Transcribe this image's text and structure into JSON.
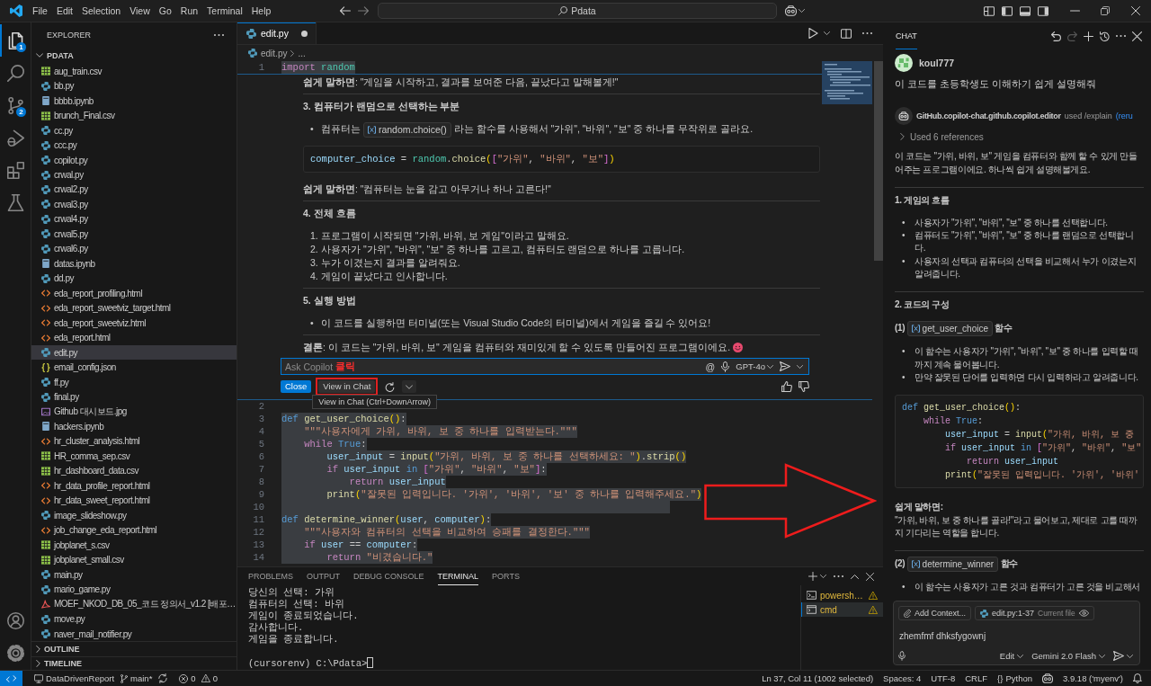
{
  "title_bar": {
    "menu": [
      "File",
      "Edit",
      "Selection",
      "View",
      "Go",
      "Run",
      "Terminal",
      "Help"
    ],
    "search": "Pdata"
  },
  "activity_bar": {
    "items": [
      {
        "kind": "files",
        "selected": true,
        "badge": "1"
      },
      {
        "kind": "search",
        "selected": false
      },
      {
        "kind": "source-control",
        "selected": false,
        "badge": "2"
      },
      {
        "kind": "run",
        "selected": false
      },
      {
        "kind": "extensions",
        "selected": false
      },
      {
        "kind": "testing",
        "selected": false
      }
    ]
  },
  "sidebar": {
    "title": "EXPLORER",
    "folder": {
      "name": "PDATA",
      "expanded": true,
      "files": [
        {
          "name": "aug_train.csv",
          "kind": "csv",
          "selected": false
        },
        {
          "name": "bb.py",
          "kind": "python",
          "selected": false
        },
        {
          "name": "bbbb.ipynb",
          "kind": "notebook",
          "selected": false
        },
        {
          "name": "brunch_Final.csv",
          "kind": "csv",
          "selected": false
        },
        {
          "name": "cc.py",
          "kind": "python",
          "selected": false
        },
        {
          "name": "ccc.py",
          "kind": "python",
          "selected": false
        },
        {
          "name": "copilot.py",
          "kind": "python",
          "selected": false
        },
        {
          "name": "crwal.py",
          "kind": "python",
          "selected": false
        },
        {
          "name": "crwal2.py",
          "kind": "python",
          "selected": false
        },
        {
          "name": "crwal3.py",
          "kind": "python",
          "selected": false
        },
        {
          "name": "crwal4.py",
          "kind": "python",
          "selected": false
        },
        {
          "name": "crwal5.py",
          "kind": "python",
          "selected": false
        },
        {
          "name": "crwal6.py",
          "kind": "python",
          "selected": false
        },
        {
          "name": "datas.ipynb",
          "kind": "notebook",
          "selected": false
        },
        {
          "name": "dd.py",
          "kind": "python",
          "selected": false
        },
        {
          "name": "eda_report_profiling.html",
          "kind": "html",
          "selected": false
        },
        {
          "name": "eda_report_sweetviz_target.html",
          "kind": "html",
          "selected": false
        },
        {
          "name": "eda_report_sweetviz.html",
          "kind": "html",
          "selected": false
        },
        {
          "name": "eda_report.html",
          "kind": "html",
          "selected": false
        },
        {
          "name": "edit.py",
          "kind": "python",
          "selected": true
        },
        {
          "name": "email_config.json",
          "kind": "json",
          "selected": false
        },
        {
          "name": "ff.py",
          "kind": "python",
          "selected": false
        },
        {
          "name": "final.py",
          "kind": "python",
          "selected": false
        },
        {
          "name": "Github 대시보드.jpg",
          "kind": "image",
          "selected": false
        },
        {
          "name": "hackers.ipynb",
          "kind": "notebook",
          "selected": false
        },
        {
          "name": "hr_cluster_analysis.html",
          "kind": "html",
          "selected": false
        },
        {
          "name": "HR_comma_sep.csv",
          "kind": "csv",
          "selected": false
        },
        {
          "name": "hr_dashboard_data.csv",
          "kind": "csv",
          "selected": false
        },
        {
          "name": "hr_data_profile_report.html",
          "kind": "html",
          "selected": false
        },
        {
          "name": "hr_data_sweet_report.html",
          "kind": "html",
          "selected": false
        },
        {
          "name": "image_slideshow.py",
          "kind": "python",
          "selected": false
        },
        {
          "name": "job_change_eda_report.html",
          "kind": "html",
          "selected": false
        },
        {
          "name": "jobplanet_s.csv",
          "kind": "csv",
          "selected": false
        },
        {
          "name": "jobplanet_small.csv",
          "kind": "csv",
          "selected": false
        },
        {
          "name": "main.py",
          "kind": "python",
          "selected": false
        },
        {
          "name": "mario_game.py",
          "kind": "python",
          "selected": false
        },
        {
          "name": "MOEF_NKOD_DB_05_코드 정의서_v1.2 [배포…",
          "kind": "pdf",
          "selected": false
        },
        {
          "name": "move.py",
          "kind": "python",
          "selected": false
        },
        {
          "name": "naver_mail_notifier.py",
          "kind": "python",
          "selected": false
        }
      ]
    },
    "sections": [
      {
        "name": "OUTLINE",
        "expanded": false
      },
      {
        "name": "TIMELINE",
        "expanded": false
      }
    ]
  },
  "editor": {
    "tabs": [
      {
        "label": "edit.py",
        "kind": "python",
        "selected": true,
        "modified": true
      }
    ],
    "breadcrumb": [
      "edit.py",
      "..."
    ],
    "code_top": [
      {
        "number": "1",
        "selected": true,
        "tokens": [
          {
            "text": "import",
            "kind": "control"
          },
          {
            "text": " random",
            "kind": "module"
          }
        ]
      }
    ],
    "inline_chat": {
      "blocks": [
        {
          "kind": "paragraph",
          "text": "**쉽게 말하면**: \"게임을 시작하고, 결과를 보여준 다음, 끝났다고 말해볼게!\""
        },
        {
          "kind": "rule"
        },
        {
          "kind": "heading",
          "text": "3. 컴퓨터가 랜덤으로 선택하는 부분"
        },
        {
          "kind": "list",
          "items": [
            {
              "marker": "•",
              "parts": [
                {
                  "kind": "text",
                  "text": "컴퓨터는"
                },
                {
                  "kind": "symbol",
                  "text": "random.choice()"
                },
                {
                  "kind": "text",
                  "text": "라는 함수를 사용해서 \"가위\", \"바위\", \"보\" 중 하나를 무작위로 골라요."
                }
              ]
            }
          ]
        },
        {
          "kind": "code",
          "lines": [
            [
              {
                "text": "computer_choice",
                "kind": "variable"
              },
              {
                "text": " = ",
                "kind": "plain"
              },
              {
                "text": "random",
                "kind": "module"
              },
              {
                "text": ".",
                "kind": "plain"
              },
              {
                "text": "choice",
                "kind": "function"
              },
              {
                "text": "(",
                "kind": "paren"
              },
              {
                "text": "[",
                "kind": "bracket"
              },
              {
                "text": "\"가위\"",
                "kind": "string"
              },
              {
                "text": ", ",
                "kind": "plain"
              },
              {
                "text": "\"바위\"",
                "kind": "string"
              },
              {
                "text": ", ",
                "kind": "plain"
              },
              {
                "text": "\"보\"",
                "kind": "string"
              },
              {
                "text": "]",
                "kind": "bracket"
              },
              {
                "text": ")",
                "kind": "paren"
              }
            ]
          ]
        },
        {
          "kind": "paragraph",
          "text": "**쉽게 말하면**: \"컴퓨터는 눈을 감고 아무거나 하나 고른다!\""
        },
        {
          "kind": "rule"
        },
        {
          "kind": "heading",
          "text": "4. 전체 흐름"
        },
        {
          "kind": "list",
          "items": [
            {
              "marker": "1.",
              "text": "프로그램이 시작되면 \"가위, 바위, 보 게임\"이라고 말해요."
            },
            {
              "marker": "2.",
              "text": "사용자가 \"가위\", \"바위\", \"보\" 중 하나를 고르고, 컴퓨터도 랜덤으로 하나를 고릅니다."
            },
            {
              "marker": "3.",
              "text": "누가 이겼는지 결과를 알려줘요."
            },
            {
              "marker": "4.",
              "text": "게임이 끝났다고 인사합니다."
            }
          ]
        },
        {
          "kind": "rule"
        },
        {
          "kind": "heading",
          "text": "5. 실행 방법"
        },
        {
          "kind": "list",
          "items": [
            {
              "marker": "•",
              "text": "이 코드를 실행하면 터미널(또는 Visual Studio Code의 터미널)에서 게임을 즐길 수 있어요!"
            }
          ]
        },
        {
          "kind": "rule"
        },
        {
          "kind": "paragraph",
          "text": "**결론**: 이 코드는 \"가위, 바위, 보\" 게임을 컴퓨터와 재미있게 할 수 있도록 만들어진 프로그램이에요.",
          "smiley": true
        }
      ],
      "input": {
        "placeholder": "Ask Copilot",
        "annotation": "클릭",
        "mention": "@",
        "model": "GPT-4o"
      },
      "actions": [
        {
          "kind": "primary",
          "label": "Close",
          "highlighted": false
        },
        {
          "kind": "secondary",
          "label": "View in Chat",
          "highlighted": true,
          "tooltip": "View in Chat (Ctrl+DownArrow)"
        },
        {
          "kind": "rerun"
        },
        {
          "kind": "menu"
        }
      ]
    },
    "code_bottom": [
      {
        "number": "2",
        "selected": false
      },
      {
        "number": "3",
        "selected": true,
        "tokens": [
          {
            "text": "def ",
            "kind": "keyword"
          },
          {
            "text": "get_user_choice",
            "kind": "function"
          },
          {
            "text": "()",
            "kind": "paren"
          },
          {
            "text": ":",
            "kind": "plain"
          }
        ]
      },
      {
        "number": "4",
        "selected": true,
        "tokens": [
          {
            "text": "    \"\"\"사용자에게 가위, 바위, 보 중 하나를 입력받는다.\"\"\"",
            "kind": "string"
          }
        ]
      },
      {
        "number": "5",
        "selected": true,
        "tokens": [
          {
            "text": "    while ",
            "kind": "control"
          },
          {
            "text": "True",
            "kind": "keyword"
          },
          {
            "text": ":",
            "kind": "plain"
          }
        ]
      },
      {
        "number": "6",
        "selected": true,
        "tokens": [
          {
            "text": "        user_input",
            "kind": "variable"
          },
          {
            "text": " = ",
            "kind": "plain"
          },
          {
            "text": "input",
            "kind": "function"
          },
          {
            "text": "(",
            "kind": "paren"
          },
          {
            "text": "\"가위, 바위, 보 중 하나를 선택하세요: \"",
            "kind": "string"
          },
          {
            "text": ")",
            "kind": "paren"
          },
          {
            "text": ".",
            "kind": "plain"
          },
          {
            "text": "strip",
            "kind": "function"
          },
          {
            "text": "()",
            "kind": "paren"
          }
        ]
      },
      {
        "number": "7",
        "selected": true,
        "tokens": [
          {
            "text": "        if ",
            "kind": "control"
          },
          {
            "text": "user_input ",
            "kind": "variable"
          },
          {
            "text": "in ",
            "kind": "keyword"
          },
          {
            "text": "[",
            "kind": "bracket"
          },
          {
            "text": "\"가위\"",
            "kind": "string"
          },
          {
            "text": ", ",
            "kind": "plain"
          },
          {
            "text": "\"바위\"",
            "kind": "string"
          },
          {
            "text": ", ",
            "kind": "plain"
          },
          {
            "text": "\"보\"",
            "kind": "string"
          },
          {
            "text": "]",
            "kind": "bracket"
          },
          {
            "text": ":",
            "kind": "plain"
          }
        ]
      },
      {
        "number": "8",
        "selected": true,
        "tokens": [
          {
            "text": "            return ",
            "kind": "control"
          },
          {
            "text": "user_input",
            "kind": "variable"
          }
        ]
      },
      {
        "number": "9",
        "selected": true,
        "tokens": [
          {
            "text": "        print",
            "kind": "function"
          },
          {
            "text": "(",
            "kind": "paren"
          },
          {
            "text": "\"잘못된 입력입니다. '가위', '바위', '보' 중 하나를 입력해주세요.\"",
            "kind": "string"
          },
          {
            "text": ")",
            "kind": "paren"
          }
        ]
      },
      {
        "number": "10",
        "selected": true
      },
      {
        "number": "11",
        "selected": true,
        "tokens": [
          {
            "text": "def ",
            "kind": "keyword"
          },
          {
            "text": "determine_winner",
            "kind": "function"
          },
          {
            "text": "(",
            "kind": "paren"
          },
          {
            "text": "user",
            "kind": "variable"
          },
          {
            "text": ", ",
            "kind": "plain"
          },
          {
            "text": "computer",
            "kind": "variable"
          },
          {
            "text": ")",
            "kind": "paren"
          },
          {
            "text": ":",
            "kind": "plain"
          }
        ]
      },
      {
        "number": "12",
        "selected": true,
        "tokens": [
          {
            "text": "    \"\"\"사용자와 컴퓨터의 선택을 비교하여 승패를 결정한다.\"\"\"",
            "kind": "string"
          }
        ]
      },
      {
        "number": "13",
        "selected": true,
        "tokens": [
          {
            "text": "    if ",
            "kind": "control"
          },
          {
            "text": "user ",
            "kind": "variable"
          },
          {
            "text": "== ",
            "kind": "plain"
          },
          {
            "text": "computer",
            "kind": "variable"
          },
          {
            "text": ":",
            "kind": "plain"
          }
        ]
      },
      {
        "number": "14",
        "selected": true,
        "tokens": [
          {
            "text": "        return ",
            "kind": "control"
          },
          {
            "text": "\"비겼습니다.\"",
            "kind": "string"
          }
        ]
      }
    ],
    "arrow_annotation": true
  },
  "panel": {
    "tabs": [
      {
        "label": "PROBLEMS",
        "selected": false
      },
      {
        "label": "OUTPUT",
        "selected": false
      },
      {
        "label": "DEBUG CONSOLE",
        "selected": false
      },
      {
        "label": "TERMINAL",
        "selected": true
      },
      {
        "label": "PORTS",
        "selected": false
      }
    ],
    "terminal": {
      "lines": [
        "당신의 선택: 가위",
        "컴퓨터의 선택: 바위",
        "게임이 종료되었습니다.",
        "감사합니다.",
        "게임을 종료합니다."
      ],
      "prompt": "(cursorenv) C:\\Pdata>"
    },
    "terminals": [
      {
        "label": "powersh…",
        "kind": "powershell",
        "selected": false
      },
      {
        "label": "cmd",
        "kind": "cmd",
        "selected": true
      }
    ]
  },
  "chat": {
    "tabs": [
      {
        "label": "CHAT",
        "selected": true
      }
    ],
    "header_actions": [
      {
        "kind": "undo",
        "disabled": false
      },
      {
        "kind": "redo",
        "disabled": true
      },
      {
        "kind": "new",
        "disabled": false
      },
      {
        "kind": "history",
        "disabled": false
      },
      {
        "kind": "more",
        "disabled": false
      },
      {
        "kind": "close",
        "disabled": false
      }
    ],
    "request": {
      "user": "koul777",
      "text": "이 코드를 초등학생도 이해하기 쉽게 설명해줘"
    },
    "response": {
      "agent": "GitHub.copilot-chat.github.copilot.editor",
      "used": "used /explain",
      "rerun": "(reru",
      "references": {
        "label": "Used 6 references",
        "expanded": false
      },
      "blocks": [
        {
          "kind": "paragraph",
          "text": "이 코드는 \"가위, 바위, 보\" 게임을 컴퓨터와 함께 할 수 있게 만들어주는 프로그램이에요. 하나씩 쉽게 설명해볼게요."
        },
        {
          "kind": "rule"
        },
        {
          "kind": "heading",
          "text": "1. 게임의 흐름"
        },
        {
          "kind": "list",
          "items": [
            {
              "marker": "•",
              "text": "사용자가 \"가위\", \"바위\", \"보\" 중 하나를 선택합니다."
            },
            {
              "marker": "•",
              "text": "컴퓨터도 \"가위\", \"바위\", \"보\" 중 하나를 랜덤으로 선택합니다."
            },
            {
              "marker": "•",
              "text": "사용자의 선택과 컴퓨터의 선택을 비교해서 누가 이겼는지 알려줍니다."
            }
          ]
        },
        {
          "kind": "rule"
        },
        {
          "kind": "heading",
          "text": "2. 코드의 구성"
        },
        {
          "kind": "heading",
          "parts": [
            {
              "kind": "text",
              "text": "(1)"
            },
            {
              "kind": "symbol",
              "text": "get_user_choice"
            },
            {
              "kind": "text",
              "text": "함수"
            }
          ]
        },
        {
          "kind": "list",
          "items": [
            {
              "marker": "•",
              "text": "이 함수는 사용자가 \"가위\", \"바위\", \"보\" 중 하나를 입력할 때까지 계속 물어봅니다."
            },
            {
              "marker": "•",
              "text": "만약 잘못된 단어를 입력하면 다시 입력하라고 알려줍니다."
            }
          ]
        },
        {
          "kind": "code",
          "lines": [
            [
              {
                "text": "def ",
                "kind": "keyword"
              },
              {
                "text": "get_user_choice",
                "kind": "function"
              },
              {
                "text": "()",
                "kind": "paren"
              },
              {
                "text": ":",
                "kind": "plain"
              }
            ],
            [
              {
                "text": "    while ",
                "kind": "control"
              },
              {
                "text": "True",
                "kind": "keyword"
              },
              {
                "text": ":",
                "kind": "plain"
              }
            ],
            [
              {
                "text": "        user_input",
                "kind": "variable"
              },
              {
                "text": " = ",
                "kind": "plain"
              },
              {
                "text": "input",
                "kind": "function"
              },
              {
                "text": "(",
                "kind": "paren"
              },
              {
                "text": "\"가위, 바위, 보 중",
                "kind": "string"
              }
            ],
            [
              {
                "text": "        if ",
                "kind": "control"
              },
              {
                "text": "user_input ",
                "kind": "variable"
              },
              {
                "text": "in ",
                "kind": "keyword"
              },
              {
                "text": "[",
                "kind": "bracket"
              },
              {
                "text": "\"가위\"",
                "kind": "string"
              },
              {
                "text": ", ",
                "kind": "plain"
              },
              {
                "text": "\"바위\"",
                "kind": "string"
              },
              {
                "text": ", ",
                "kind": "plain"
              },
              {
                "text": "\"보\"",
                "kind": "string"
              }
            ],
            [
              {
                "text": "            return ",
                "kind": "control"
              },
              {
                "text": "user_input",
                "kind": "variable"
              }
            ],
            [
              {
                "text": "        print",
                "kind": "function"
              },
              {
                "text": "(",
                "kind": "paren"
              },
              {
                "text": "\"잘못된 입력입니다. '가위', '바위'",
                "kind": "string"
              }
            ]
          ]
        },
        {
          "kind": "strong",
          "text": "쉽게 말하면:"
        },
        {
          "kind": "paragraph",
          "text": "\"가위, 바위, 보 중 하나를 골라!\"라고 물어보고, 제대로 고를 때까지 기다리는 역할을 합니다."
        },
        {
          "kind": "rule"
        },
        {
          "kind": "heading",
          "parts": [
            {
              "kind": "text",
              "text": "(2)"
            },
            {
              "kind": "symbol",
              "text": "determine_winner"
            },
            {
              "kind": "text",
              "text": "함수"
            }
          ]
        },
        {
          "kind": "list",
          "items": [
            {
              "marker": "•",
              "text": "이 함수는 사용자가 고른 것과 컴퓨터가 고른 것을 비교해서"
            }
          ]
        }
      ]
    },
    "input": {
      "context": [
        {
          "kind": "attach",
          "label": "Add Context..."
        },
        {
          "kind": "file",
          "label": "edit.py:1-37",
          "detail": "Current file"
        }
      ],
      "value": "zhemfmf dhksfygownj",
      "mode": "Edit",
      "model": "Gemini 2.0 Flash"
    }
  },
  "status_bar": {
    "left": [
      {
        "kind": "remote"
      },
      {
        "kind": "project",
        "text": "DataDrivenReport"
      },
      {
        "kind": "branch",
        "text": "main*"
      },
      {
        "kind": "sync"
      },
      {
        "kind": "problems",
        "errors": "0",
        "warnings": "0"
      }
    ],
    "right": [
      {
        "kind": "text",
        "text": "Ln 37, Col 11 (1002 selected)"
      },
      {
        "kind": "text",
        "text": "Spaces: 4"
      },
      {
        "kind": "text",
        "text": "UTF-8"
      },
      {
        "kind": "text",
        "text": "CRLF"
      },
      {
        "kind": "language",
        "icon_text": "{}",
        "text": "Python"
      },
      {
        "kind": "copilot"
      },
      {
        "kind": "text",
        "text": "3.9.18 ('myenv')"
      },
      {
        "kind": "notifications"
      }
    ]
  }
}
